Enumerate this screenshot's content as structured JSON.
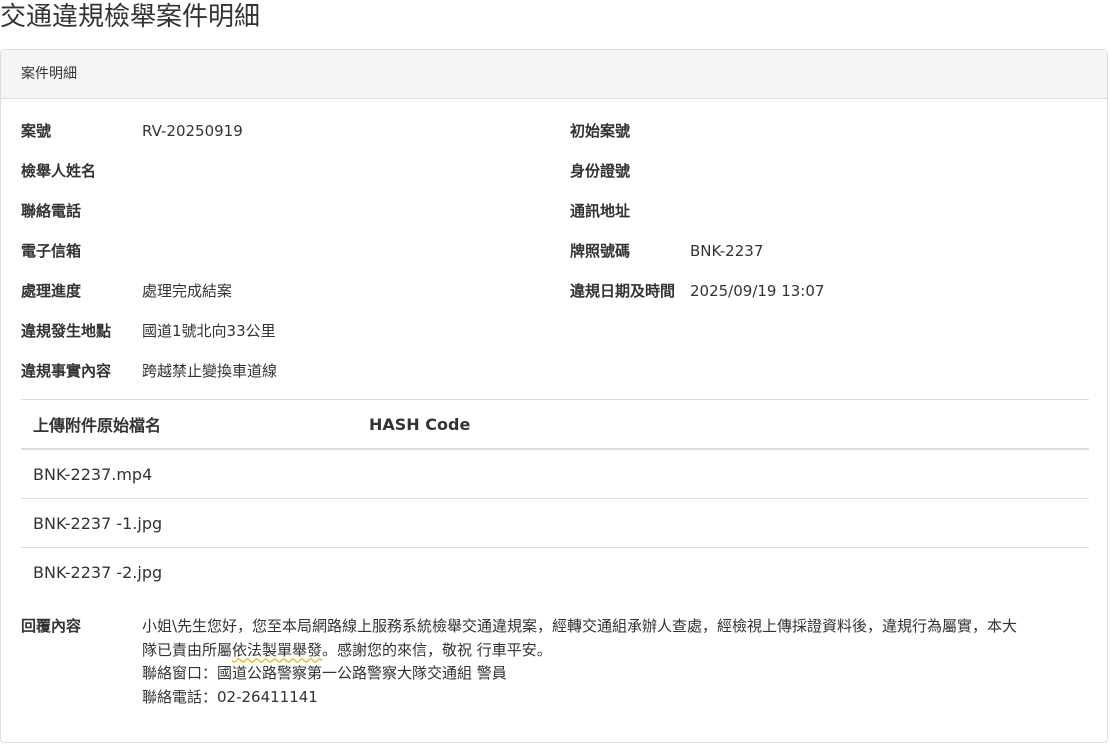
{
  "page_title": "交通違規檢舉案件明細",
  "panel_heading": "案件明細",
  "fields": {
    "case_no": {
      "label": "案號",
      "value": "RV-20250919"
    },
    "original_case_no": {
      "label": "初始案號",
      "value": ""
    },
    "reporter_name": {
      "label": "檢舉人姓名",
      "value": ""
    },
    "id_number": {
      "label": "身份證號",
      "value": ""
    },
    "phone": {
      "label": "聯絡電話",
      "value": ""
    },
    "address": {
      "label": "通訊地址",
      "value": ""
    },
    "email": {
      "label": "電子信箱",
      "value": ""
    },
    "plate_no": {
      "label": "牌照號碼",
      "value": "BNK-2237"
    },
    "progress": {
      "label": "處理進度",
      "value": "處理完成結案"
    },
    "violation_datetime": {
      "label": "違規日期及時間",
      "value": "2025/09/19 13:07"
    },
    "location": {
      "label": "違規發生地點",
      "value": "國道1號北向33公里"
    },
    "violation_content": {
      "label": "違規事實內容",
      "value": "跨越禁止變換車道線"
    }
  },
  "attachments": {
    "headers": {
      "filename": "上傳附件原始檔名",
      "hash": "HASH Code"
    },
    "rows": [
      {
        "filename": "BNK-2237.mp4",
        "hash": ""
      },
      {
        "filename": "BNK-2237 -1.jpg",
        "hash": ""
      },
      {
        "filename": "BNK-2237 -2.jpg",
        "hash": ""
      }
    ]
  },
  "reply": {
    "label": "回覆內容",
    "line1": "小姐\\先生您好，您至本局網路線上服務系統檢舉交通違規案，經轉交通組承辦人查處，經檢視上傳採證資料後，違規行為屬實，本大",
    "line2_pre": "隊已責由所屬",
    "line2_mark": "依法製單舉發",
    "line2_post": "。感謝您的來信，敬祝 行車平安。",
    "contact": "聯絡窗口：國道公路警察第一公路警察大隊交通組 警員",
    "contact_phone": "聯絡電話：02-26411141"
  }
}
